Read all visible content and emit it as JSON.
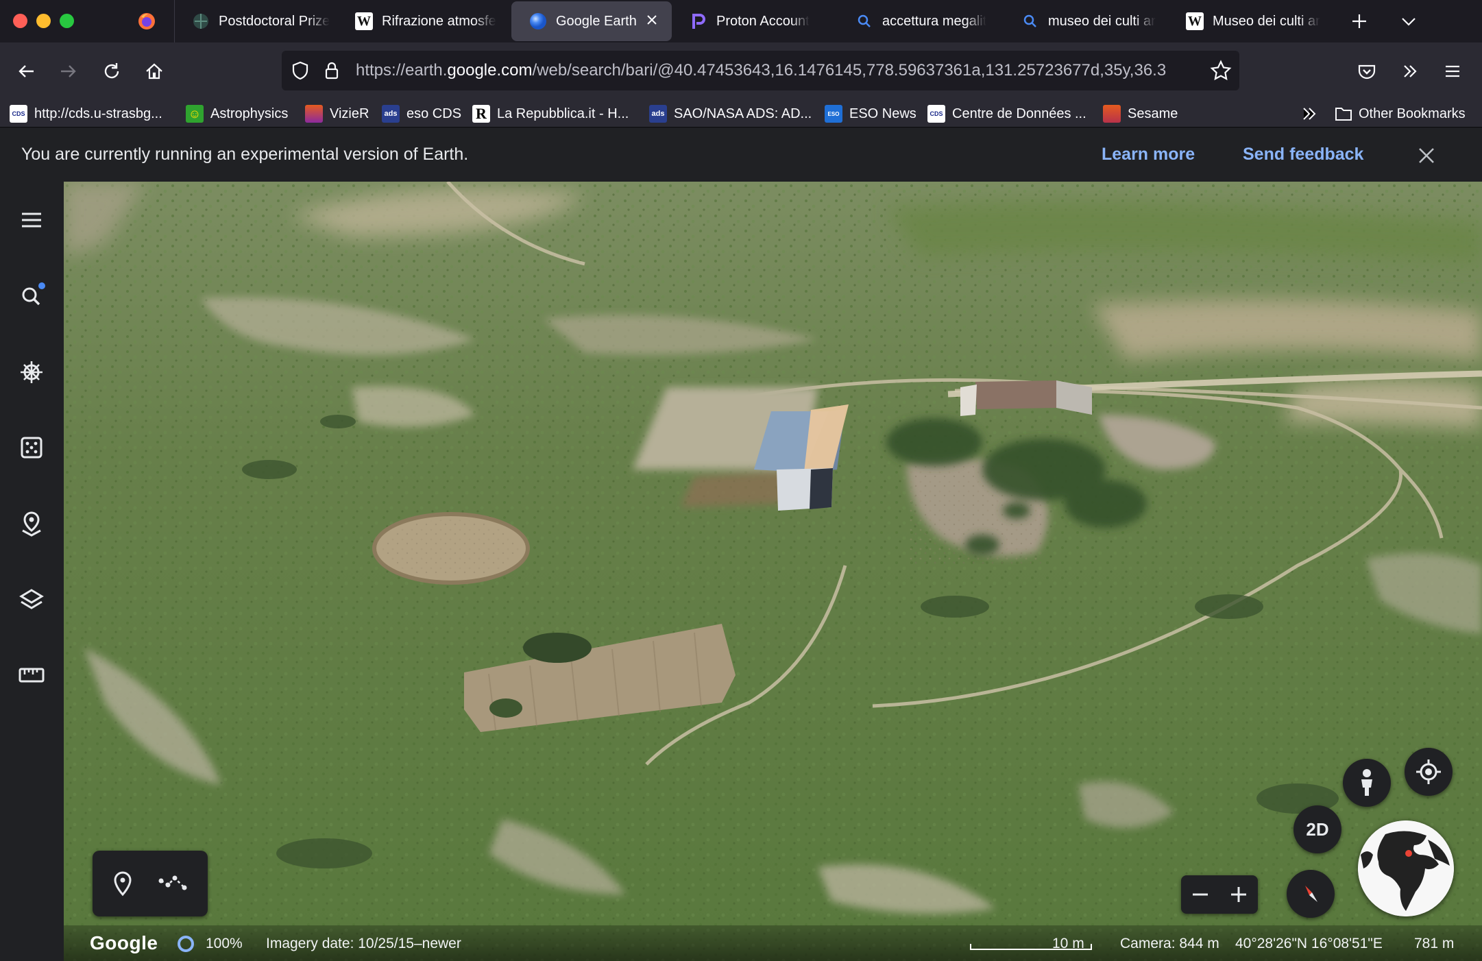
{
  "browser": {
    "tabs": [
      {
        "title": "Postdoctoral Prize",
        "favicon": "globe-dark-icon"
      },
      {
        "title": "Rifrazione atmosfe",
        "favicon": "wikipedia-icon"
      },
      {
        "title": "Google Earth",
        "favicon": "earth-icon",
        "active": true
      },
      {
        "title": "Proton Account",
        "favicon": "proton-icon"
      },
      {
        "title": "accettura megalit",
        "favicon": "search-icon"
      },
      {
        "title": "museo dei culti ar",
        "favicon": "search-icon"
      },
      {
        "title": "Museo dei culti ar",
        "favicon": "wikipedia-icon"
      }
    ],
    "wikipedia_glyph": "W",
    "url": {
      "prefix": "https://earth.",
      "domain": "google.com",
      "rest": "/web/search/bari/@40.47453643,16.1476145,778.59637361a,131.25723677d,35y,36.3"
    },
    "bookmarks": [
      {
        "label": "http://cds.u-strasbg...",
        "icon": "cds-icon",
        "badge": "CDS"
      },
      {
        "label": "Astrophysics",
        "icon": "smiley-icon",
        "badge": "☺"
      },
      {
        "label": "VizieR",
        "icon": "vizier-icon",
        "badge": ""
      },
      {
        "label": "eso CDS",
        "icon": "ads-icon",
        "badge": "ads"
      },
      {
        "label": "La Repubblica.it - H...",
        "icon": "repubblica-icon",
        "badge": "R"
      },
      {
        "label": "SAO/NASA ADS: AD...",
        "icon": "ads-icon",
        "badge": "ads"
      },
      {
        "label": "ESO News",
        "icon": "eso-icon",
        "badge": "ESO"
      },
      {
        "label": "Centre de Données ...",
        "icon": "cds-icon",
        "badge": "CDS"
      },
      {
        "label": "Sesame",
        "icon": "sesame-icon",
        "badge": ""
      }
    ],
    "other_bookmarks": "Other Bookmarks"
  },
  "notice": {
    "text": "You are currently running an experimental version of Earth.",
    "learn_more": "Learn more",
    "send_feedback": "Send feedback"
  },
  "earth": {
    "view_2d": "2D",
    "status": {
      "logo": "Google",
      "load_percent": "100%",
      "imagery_date": "Imagery date: 10/25/15–newer",
      "scale": "10 m",
      "camera": "Camera: 844 m",
      "coords": "40°28'26\"N 16°08'51\"E",
      "elevation": "781 m"
    }
  },
  "colors": {
    "accent_link": "#8ab4f8",
    "close_red": "#ff5f57",
    "min_yellow": "#febc2e",
    "max_green": "#28c840"
  }
}
